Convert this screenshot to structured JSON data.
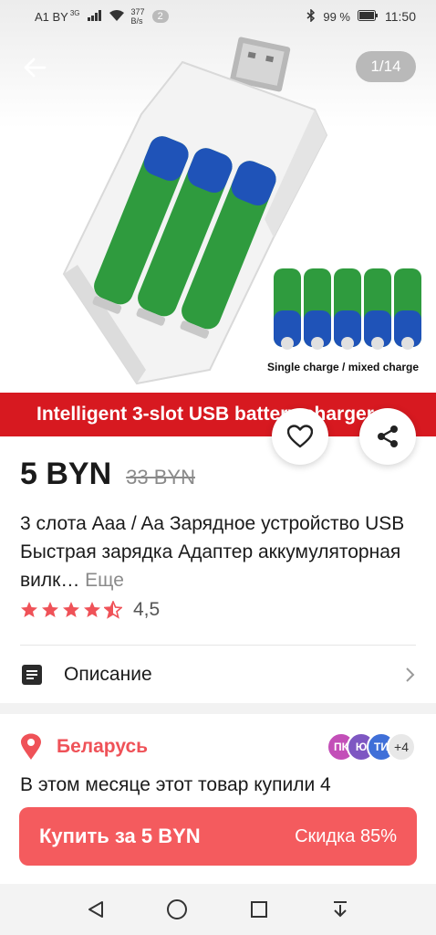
{
  "status_bar": {
    "carrier": "A1 BY",
    "network": "3G",
    "speed_value": "377",
    "speed_unit": "B/s",
    "notification_count": "2",
    "battery": "99 %",
    "time": "11:50"
  },
  "gallery": {
    "counter": "1/14",
    "caption": "Single charge / mixed charge",
    "banner_text": "Intelligent 3-slot USB battery charger"
  },
  "product": {
    "price": "5 BYN",
    "old_price": "33 BYN",
    "title": "3 слота Aaa / Aa Зарядное устройство USB Быстрая зарядка Адаптер аккумуляторная вилк…",
    "more_label": "Еще",
    "rating": "4,5",
    "stars": 4.5
  },
  "description_label": "Описание",
  "location": {
    "country": "Беларусь",
    "avatars": [
      {
        "label": "ПК",
        "color": "#c34fb8"
      },
      {
        "label": "Ю",
        "color": "#7e57c2"
      },
      {
        "label": "ТИ",
        "color": "#3f6fd8"
      }
    ],
    "more_count": "+4"
  },
  "bought_text": "В этом месяце этот товар купили 4",
  "buy_button": {
    "label": "Купить за 5 BYN",
    "discount": "Скидка 85%"
  },
  "colors": {
    "accent": "#f45b5e",
    "star": "#ef5258",
    "banner": "#d71920"
  }
}
